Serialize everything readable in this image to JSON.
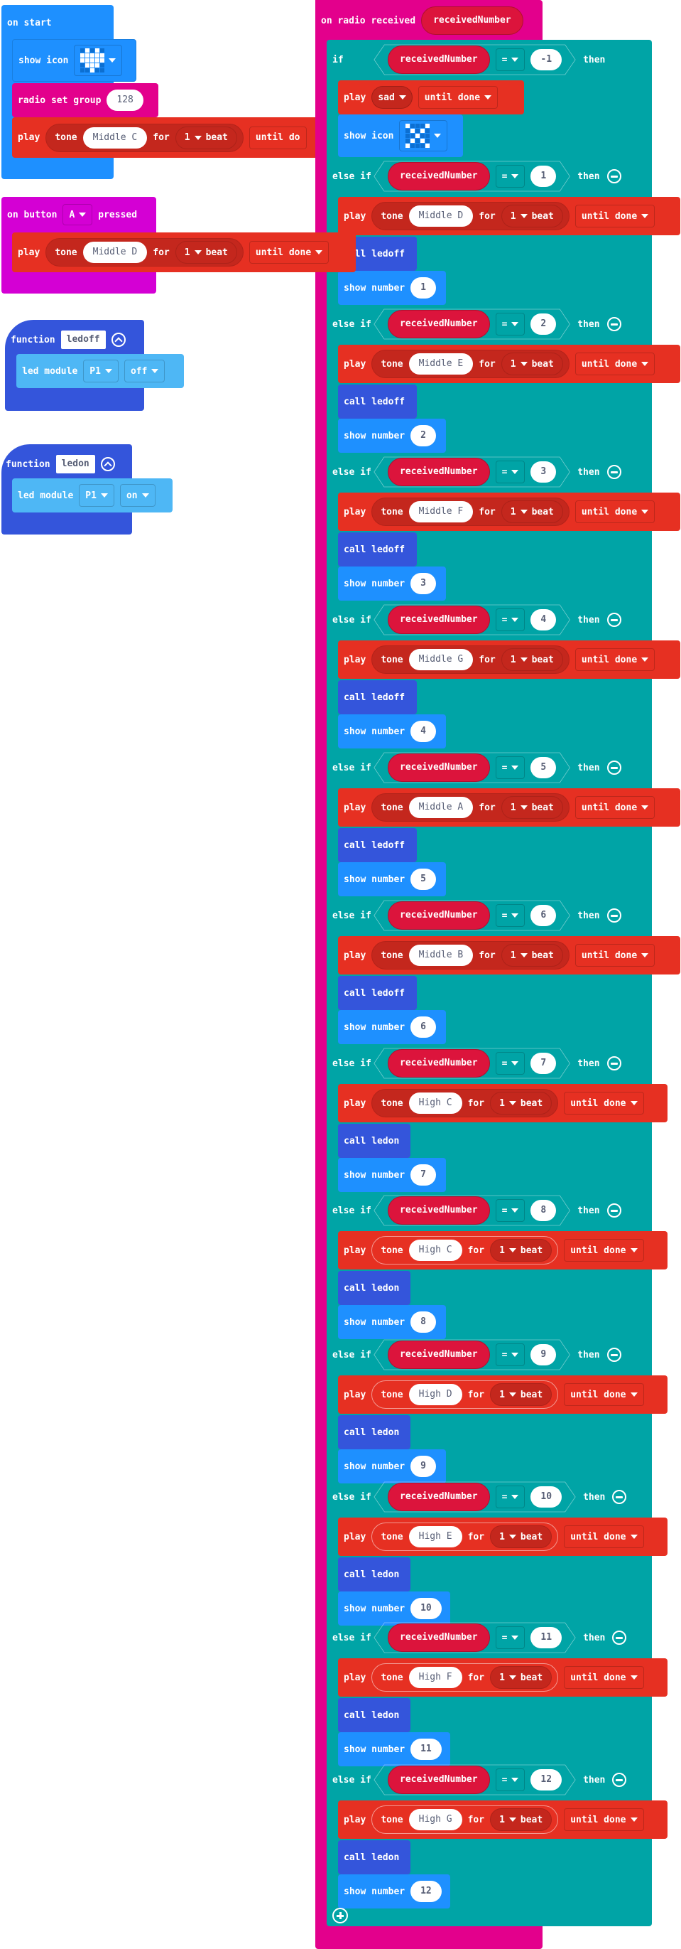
{
  "on_start": {
    "header": "on start",
    "show_icon": {
      "label": "show icon",
      "icon": "heart-icon",
      "leds": [
        [
          0,
          1,
          0,
          1,
          0
        ],
        [
          1,
          1,
          1,
          1,
          1
        ],
        [
          1,
          1,
          1,
          1,
          1
        ],
        [
          0,
          1,
          1,
          1,
          0
        ],
        [
          0,
          0,
          1,
          0,
          0
        ]
      ]
    },
    "radio_set_group": {
      "label": "radio set group",
      "value": "128"
    },
    "play": {
      "play": "play",
      "tone": "tone",
      "note": "Middle C",
      "for": "for",
      "beats": "1",
      "beat": "beat",
      "mode": "until do"
    }
  },
  "on_button": {
    "on": "on button",
    "button": "A",
    "pressed": "pressed",
    "play": {
      "play": "play",
      "tone": "tone",
      "note": "Middle D",
      "for": "for",
      "beats": "1",
      "beat": "beat",
      "mode": "until done"
    }
  },
  "functions": [
    {
      "keyword": "function",
      "name": "ledoff",
      "body": {
        "label": "led module",
        "pin": "P1",
        "state": "off"
      }
    },
    {
      "keyword": "function",
      "name": "ledon",
      "body": {
        "label": "led module",
        "pin": "P1",
        "state": "on"
      }
    }
  ],
  "radio": {
    "header": "on radio received",
    "param": "receivedNumber",
    "if_block": {
      "if": "if",
      "else_if": "else if",
      "then": "then",
      "first": {
        "var": "receivedNumber",
        "op": "=",
        "value": "-1",
        "play_sound": {
          "play": "play",
          "sound": "sad",
          "mode": "until done"
        },
        "show_icon": {
          "label": "show icon",
          "icon": "no-icon",
          "leds": [
            [
              1,
              0,
              0,
              0,
              1
            ],
            [
              0,
              1,
              0,
              1,
              0
            ],
            [
              0,
              0,
              1,
              0,
              0
            ],
            [
              0,
              1,
              0,
              1,
              0
            ],
            [
              1,
              0,
              0,
              0,
              1
            ]
          ]
        }
      },
      "cases": [
        {
          "value": "1",
          "note": "Middle D",
          "call": "call ledoff",
          "show": "1"
        },
        {
          "value": "2",
          "note": "Middle E",
          "call": "call ledoff",
          "show": "2"
        },
        {
          "value": "3",
          "note": "Middle F",
          "call": "call ledoff",
          "show": "3"
        },
        {
          "value": "4",
          "note": "Middle G",
          "call": "call ledoff",
          "show": "4"
        },
        {
          "value": "5",
          "note": "Middle A",
          "call": "call ledoff",
          "show": "5"
        },
        {
          "value": "6",
          "note": "Middle B",
          "call": "call ledoff",
          "show": "6"
        },
        {
          "value": "7",
          "note": "High C",
          "call": "call ledon",
          "show": "7"
        },
        {
          "value": "8",
          "note": "High C",
          "call": "call ledon",
          "show": "8"
        },
        {
          "value": "9",
          "note": "High D",
          "call": "call ledon",
          "show": "9"
        },
        {
          "value": "10",
          "note": "High E",
          "call": "call ledon",
          "show": "10"
        },
        {
          "value": "11",
          "note": "High F",
          "call": "call ledon",
          "show": "11"
        },
        {
          "value": "12",
          "note": "High G",
          "call": "call ledon",
          "show": "12"
        }
      ],
      "case_common": {
        "var": "receivedNumber",
        "op": "=",
        "play": "play",
        "tone": "tone",
        "for": "for",
        "beats": "1",
        "beat": "beat",
        "mode": "until done",
        "show_number": "show number"
      }
    }
  },
  "colors": {
    "basic": "#1e90ff",
    "radio": "#e3008c",
    "music": "#e63022",
    "logic": "#00a4a6",
    "functions": "#3455db",
    "input": "#d400d4",
    "led_module": "#4eb7f5",
    "variable": "#dc143c"
  }
}
